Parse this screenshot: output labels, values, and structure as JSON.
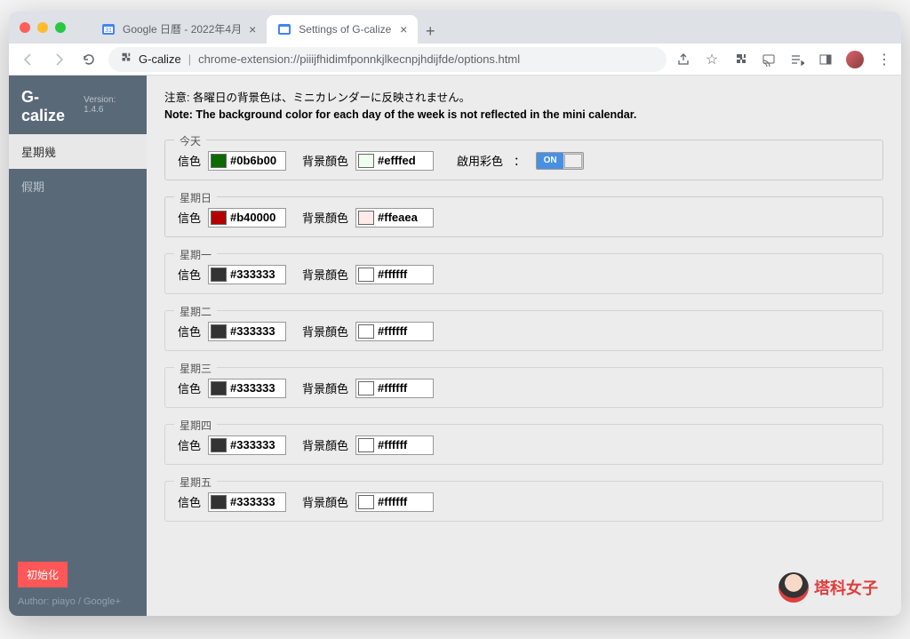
{
  "browser": {
    "tabs": [
      {
        "title": "Google 日曆 - 2022年4月",
        "active": false
      },
      {
        "title": "Settings of G-calize",
        "active": true
      }
    ],
    "new_tab": "+",
    "address": {
      "ext_name": "G-calize",
      "url": "chrome-extension://piiijfhidimfponnkjlkecnpjhdijfde/options.html"
    }
  },
  "sidebar": {
    "title": "G-calize",
    "version": "Version: 1.4.6",
    "items": [
      {
        "label": "星期幾",
        "active": true
      },
      {
        "label": "假期",
        "active": false
      }
    ],
    "init_button": "初始化",
    "author_prefix": "Author: ",
    "author_name": "piayo",
    "author_sep": " / ",
    "author_link": "Google+"
  },
  "main": {
    "note_jp": "注意: 各曜日の背景色は、ミニカレンダーに反映されません。",
    "note_en": "Note: The background color for each day of the week is not reflected in the mini calendar.",
    "labels": {
      "text_color": "信色",
      "bg_color": "背景顏色",
      "enable_color": "啟用彩色",
      "colon": "：",
      "toggle_on": "ON"
    },
    "days": [
      {
        "name": "今天",
        "text_color": "#0b6b00",
        "text_swatch": "#0b6b00",
        "bg_color": "#efffed",
        "bg_swatch": "#efffed",
        "show_toggle": true,
        "border": true
      },
      {
        "name": "星期日",
        "text_color": "#b40000",
        "text_swatch": "#b40000",
        "bg_color": "#ffeaea",
        "bg_swatch": "#ffeaea",
        "show_toggle": false,
        "border": true
      },
      {
        "name": "星期一",
        "text_color": "#333333",
        "text_swatch": "#333333",
        "bg_color": "#ffffff",
        "bg_swatch": "#ffffff",
        "show_toggle": false,
        "border": false
      },
      {
        "name": "星期二",
        "text_color": "#333333",
        "text_swatch": "#333333",
        "bg_color": "#ffffff",
        "bg_swatch": "#ffffff",
        "show_toggle": false,
        "border": false
      },
      {
        "name": "星期三",
        "text_color": "#333333",
        "text_swatch": "#333333",
        "bg_color": "#ffffff",
        "bg_swatch": "#ffffff",
        "show_toggle": false,
        "border": false
      },
      {
        "name": "星期四",
        "text_color": "#333333",
        "text_swatch": "#333333",
        "bg_color": "#ffffff",
        "bg_swatch": "#ffffff",
        "show_toggle": false,
        "border": false
      },
      {
        "name": "星期五",
        "text_color": "#333333",
        "text_swatch": "#333333",
        "bg_color": "#ffffff",
        "bg_swatch": "#ffffff",
        "show_toggle": false,
        "border": false
      }
    ]
  },
  "watermark": {
    "text": "塔科女子"
  }
}
